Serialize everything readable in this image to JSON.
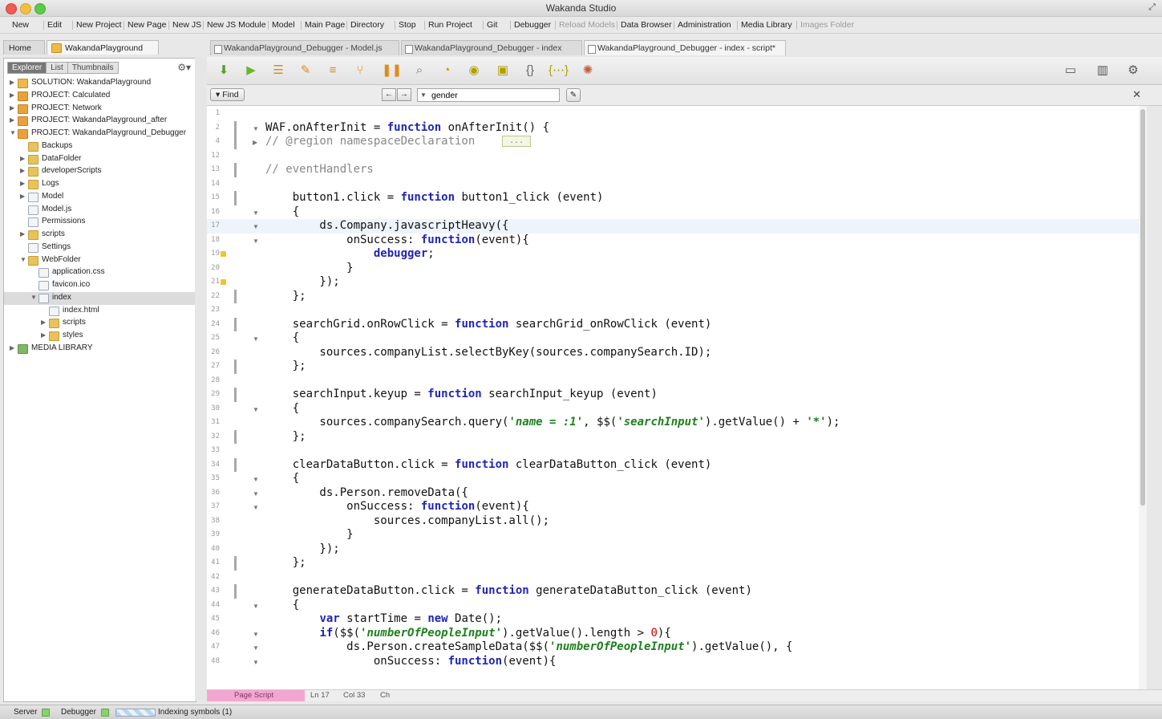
{
  "window": {
    "title": "Wakanda Studio"
  },
  "menu": [
    {
      "label": "New"
    },
    {
      "label": "Edit"
    },
    {
      "label": "New Project"
    },
    {
      "label": "New Page"
    },
    {
      "label": "New JS"
    },
    {
      "label": "New JS Module"
    },
    {
      "label": "Model"
    },
    {
      "label": "Main Page"
    },
    {
      "label": "Directory"
    },
    {
      "label": "Stop"
    },
    {
      "label": "Run Project"
    },
    {
      "label": "Git"
    },
    {
      "label": "Debugger"
    },
    {
      "label": "Reload Models",
      "disabled": true
    },
    {
      "label": "Data Browser"
    },
    {
      "label": "Administration"
    },
    {
      "label": "Media Library"
    },
    {
      "label": "Images Folder",
      "disabled": true
    }
  ],
  "left_tabs": {
    "home": "Home",
    "project": "WakandaPlayground"
  },
  "explorer": {
    "tabs": [
      "Explorer",
      "List",
      "Thumbnails"
    ],
    "tree": [
      {
        "label": "SOLUTION: WakandaPlayground",
        "icon": "sol",
        "depth": 0,
        "twisty": "▶"
      },
      {
        "label": "PROJECT: Calculated",
        "icon": "proj",
        "depth": 0,
        "twisty": "▶"
      },
      {
        "label": "PROJECT: Network",
        "icon": "proj",
        "depth": 0,
        "twisty": "▶"
      },
      {
        "label": "PROJECT: WakandaPlayground_after",
        "icon": "proj",
        "depth": 0,
        "twisty": "▶"
      },
      {
        "label": "PROJECT: WakandaPlayground_Debugger",
        "icon": "proj",
        "depth": 0,
        "twisty": "▼"
      },
      {
        "label": "Backups",
        "icon": "folder",
        "depth": 1,
        "twisty": ""
      },
      {
        "label": "DataFolder",
        "icon": "folder",
        "depth": 1,
        "twisty": "▶"
      },
      {
        "label": "developerScripts",
        "icon": "folder",
        "depth": 1,
        "twisty": "▶"
      },
      {
        "label": "Logs",
        "icon": "folder",
        "depth": 1,
        "twisty": "▶"
      },
      {
        "label": "Model",
        "icon": "file",
        "depth": 1,
        "twisty": "▶"
      },
      {
        "label": "Model.js",
        "icon": "file",
        "depth": 1,
        "twisty": ""
      },
      {
        "label": "Permissions",
        "icon": "file",
        "depth": 1,
        "twisty": ""
      },
      {
        "label": "scripts",
        "icon": "folder",
        "depth": 1,
        "twisty": "▶"
      },
      {
        "label": "Settings",
        "icon": "file",
        "depth": 1,
        "twisty": ""
      },
      {
        "label": "WebFolder",
        "icon": "folder",
        "depth": 1,
        "twisty": "▼"
      },
      {
        "label": "application.css",
        "icon": "file",
        "depth": 2,
        "twisty": ""
      },
      {
        "label": "favicon.ico",
        "icon": "file",
        "depth": 2,
        "twisty": ""
      },
      {
        "label": "index",
        "icon": "file",
        "depth": 2,
        "twisty": "▼",
        "selected": true
      },
      {
        "label": "index.html",
        "icon": "file",
        "depth": 3,
        "twisty": ""
      },
      {
        "label": "scripts",
        "icon": "folder",
        "depth": 3,
        "twisty": "▶"
      },
      {
        "label": "styles",
        "icon": "folder",
        "depth": 3,
        "twisty": "▶"
      },
      {
        "label": "MEDIA LIBRARY",
        "icon": "media",
        "depth": 0,
        "twisty": "▶"
      }
    ]
  },
  "doc_tabs": [
    {
      "label": "WakandaPlayground_Debugger - Model.js"
    },
    {
      "label": "WakandaPlayground_Debugger - index"
    },
    {
      "label": "WakandaPlayground_Debugger - index - script*",
      "active": true
    }
  ],
  "find": {
    "button": "Find",
    "prev": "←",
    "next": "→",
    "value": "gender"
  },
  "editor": {
    "lines": [
      {
        "n": "1",
        "c": ""
      },
      {
        "n": "2",
        "c": "WAF.onAfterInit = <k>function</k> onAfterInit() {",
        "fold": "▼",
        "bar": true
      },
      {
        "n": "4",
        "c": "<c>// @region namespaceDeclaration</c>    <r>...</r>",
        "fold": "▶",
        "bar": true
      },
      {
        "n": "12",
        "c": ""
      },
      {
        "n": "13",
        "c": "<c>// eventHandlers</c>",
        "bar": true
      },
      {
        "n": "14",
        "c": ""
      },
      {
        "n": "15",
        "c": "    button1.click = <k>function</k> button1_click (event)",
        "bar": true
      },
      {
        "n": "16",
        "c": "    {",
        "fold": "▼"
      },
      {
        "n": "17",
        "c": "        ds.Company.javascriptHeavy({",
        "fold": "▼",
        "cur": true
      },
      {
        "n": "18",
        "c": "            onSuccess: <k>function</k>(event){",
        "fold": "▼"
      },
      {
        "n": "19",
        "c": "                <k>debugger</k>;",
        "warn": true
      },
      {
        "n": "20",
        "c": "            }"
      },
      {
        "n": "21",
        "c": "        });",
        "warn": true
      },
      {
        "n": "22",
        "c": "    };",
        "bar": true
      },
      {
        "n": "23",
        "c": ""
      },
      {
        "n": "24",
        "c": "    searchGrid.onRowClick = <k>function</k> searchGrid_onRowClick (event)",
        "bar": true
      },
      {
        "n": "25",
        "c": "    {",
        "fold": "▼"
      },
      {
        "n": "26",
        "c": "        sources.companyList.selectByKey(sources.companySearch.ID);"
      },
      {
        "n": "27",
        "c": "    };",
        "bar": true
      },
      {
        "n": "28",
        "c": ""
      },
      {
        "n": "29",
        "c": "    searchInput.keyup = <k>function</k> searchInput_keyup (event)",
        "bar": true
      },
      {
        "n": "30",
        "c": "    {",
        "fold": "▼"
      },
      {
        "n": "31",
        "c": "        sources.companySearch.query(<s>'name = :1'</s>, $$(<s>'searchInput'</s>).getValue() + <s>'*'</s>);"
      },
      {
        "n": "32",
        "c": "    };",
        "bar": true
      },
      {
        "n": "33",
        "c": ""
      },
      {
        "n": "34",
        "c": "    clearDataButton.click = <k>function</k> clearDataButton_click (event)",
        "bar": true
      },
      {
        "n": "35",
        "c": "    {",
        "fold": "▼"
      },
      {
        "n": "36",
        "c": "        ds.Person.removeData({",
        "fold": "▼"
      },
      {
        "n": "37",
        "c": "            onSuccess: <k>function</k>(event){",
        "fold": "▼"
      },
      {
        "n": "38",
        "c": "                sources.companyList.all();"
      },
      {
        "n": "39",
        "c": "            }"
      },
      {
        "n": "40",
        "c": "        });"
      },
      {
        "n": "41",
        "c": "    };",
        "bar": true
      },
      {
        "n": "42",
        "c": ""
      },
      {
        "n": "43",
        "c": "    generateDataButton.click = <k>function</k> generateDataButton_click (event)",
        "bar": true
      },
      {
        "n": "44",
        "c": "    {",
        "fold": "▼"
      },
      {
        "n": "45",
        "c": "        <k>var</k> startTime = <k>new</k> Date();"
      },
      {
        "n": "46",
        "c": "        <k>if</k>($$(<s>'numberOfPeopleInput'</s>).getValue().length > <n>0</n>){",
        "fold": "▼"
      },
      {
        "n": "47",
        "c": "            ds.Person.createSampleData($$(<s>'numberOfPeopleInput'</s>).getValue(), {",
        "fold": "▼"
      },
      {
        "n": "48",
        "c": "                onSuccess: <k>function</k>(event){",
        "fold": "▼"
      }
    ]
  },
  "editor_status": {
    "mode": "Page Script",
    "line": "Ln 17",
    "col": "Col 33",
    "ch": "Ch"
  },
  "statusbar": {
    "server": "Server",
    "debugger": "Debugger",
    "indexing": "Indexing symbols (1)"
  }
}
